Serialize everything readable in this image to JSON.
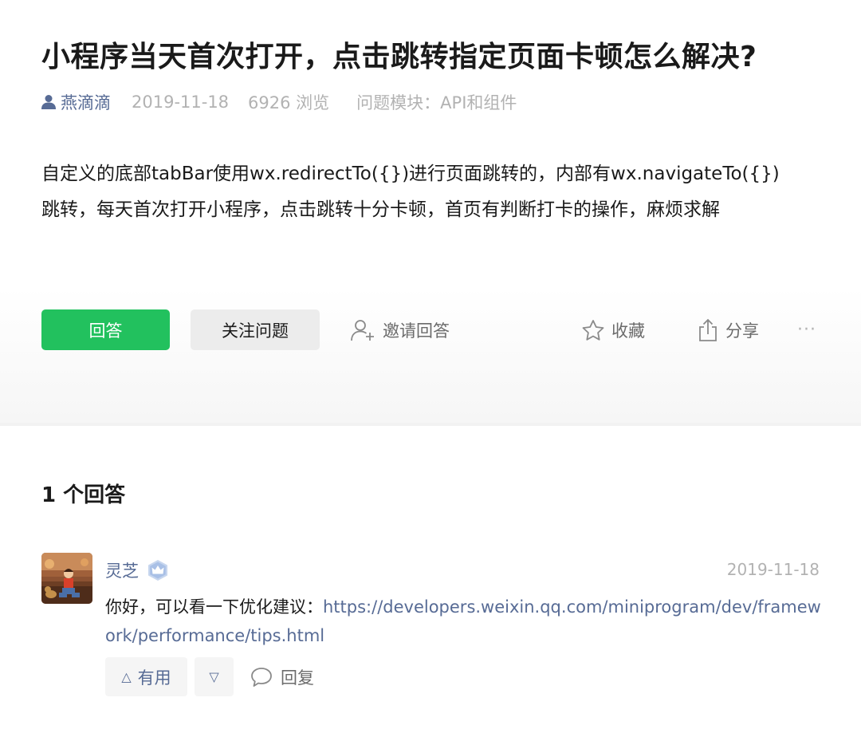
{
  "question": {
    "title": "小程序当天首次打开，点击跳转指定页面卡顿怎么解决?",
    "author": "燕滴滴",
    "date": "2019-11-18",
    "views": "6926 浏览",
    "module_label": "问题模块：",
    "module": "API和组件",
    "body_lines": [
      "自定义的底部tabBar使用wx.redirectTo({})进行页面跳转的，内部有wx.navigateTo({})",
      "跳转，每天首次打开小程序，点击跳转十分卡顿，首页有判断打卡的操作，麻烦求解"
    ]
  },
  "actions": {
    "answer": "回答",
    "follow": "关注问题",
    "invite": "邀请回答",
    "favorite": "收藏",
    "share": "分享",
    "more": "···"
  },
  "answers": {
    "count_label": "1 个回答",
    "items": [
      {
        "name": "灵芝",
        "date": "2019-11-18",
        "text_prefix": "你好，可以看一下优化建议：",
        "link": "https://developers.weixin.qq.com/miniprogram/dev/framework/performance/tips.html",
        "useful_label": "有用",
        "useful_icon": "△",
        "useless_icon": "▽",
        "reply_label": "回复"
      }
    ]
  },
  "colors": {
    "accent_green": "#22c15e",
    "link_blue": "#576b95",
    "muted_gray": "#b2b2b2"
  }
}
